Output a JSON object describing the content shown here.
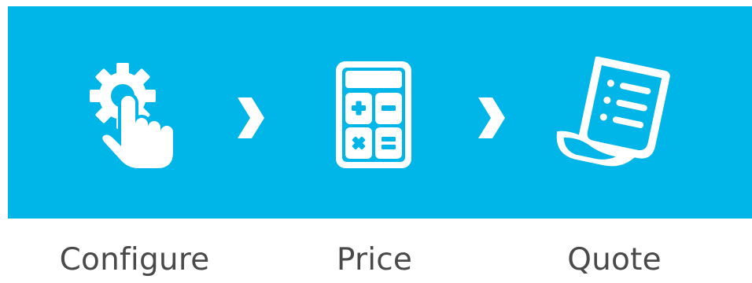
{
  "colors": {
    "banner": "#00b5e8",
    "icon": "#ffffff",
    "label_text": "#4a4a4a",
    "page_background": "#ffffff"
  },
  "steps": [
    {
      "label": "Configure",
      "icon": "gear-with-pointing-hand-icon"
    },
    {
      "label": "Price",
      "icon": "calculator-icon"
    },
    {
      "label": "Quote",
      "icon": "document-list-icon"
    }
  ],
  "separator_icon": "chevron-right-icon"
}
